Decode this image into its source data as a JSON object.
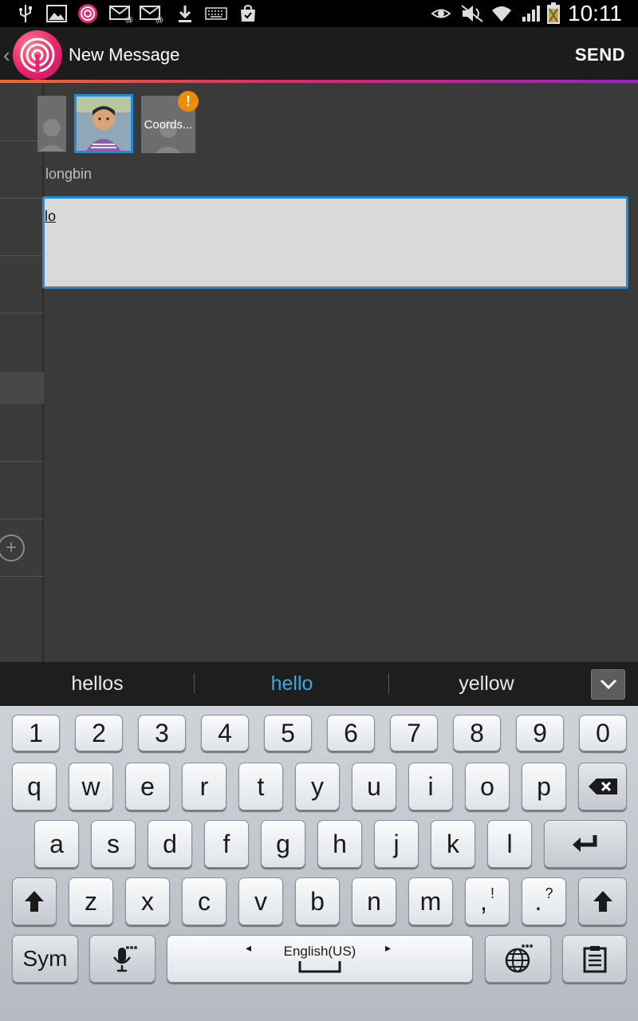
{
  "status_bar": {
    "time": "10:11",
    "left_icons": [
      "usb-icon",
      "image-icon",
      "app-notification-icon",
      "email-icon",
      "email-icon",
      "download-icon",
      "keyboard-icon",
      "store-icon"
    ],
    "right_icons": [
      "smart-stay-eye-icon",
      "mute-icon",
      "wifi-icon",
      "signal-icon",
      "battery-icon"
    ]
  },
  "action_bar": {
    "title": "New Message",
    "send_label": "SEND",
    "accent_gradient": [
      "#f06a2a",
      "#e8236b",
      "#9a21c8"
    ]
  },
  "recipients": {
    "items": [
      {
        "label": "",
        "selected": false
      },
      {
        "label": "",
        "selected": true
      },
      {
        "label": "Coords...",
        "selected": false,
        "warning": "!"
      }
    ],
    "selected_name": "longbin"
  },
  "message": {
    "text": "lo",
    "border_color": "#1e8be0"
  },
  "suggestions": {
    "items": [
      "hellos",
      "hello",
      "yellow"
    ],
    "highlight_color": "#3aa7e0"
  },
  "keyboard": {
    "row_numbers": [
      "1",
      "2",
      "3",
      "4",
      "5",
      "6",
      "7",
      "8",
      "9",
      "0"
    ],
    "row1": [
      "q",
      "w",
      "e",
      "r",
      "t",
      "y",
      "u",
      "i",
      "o",
      "p"
    ],
    "row2": [
      "a",
      "s",
      "d",
      "f",
      "g",
      "h",
      "j",
      "k",
      "l"
    ],
    "row3": [
      "z",
      "x",
      "c",
      "v",
      "b",
      "n",
      "m"
    ],
    "comma_key": ",",
    "comma_alt": "!",
    "period_key": ".",
    "period_alt": "?",
    "sym_label": "Sym",
    "language_label": "English(US)"
  }
}
